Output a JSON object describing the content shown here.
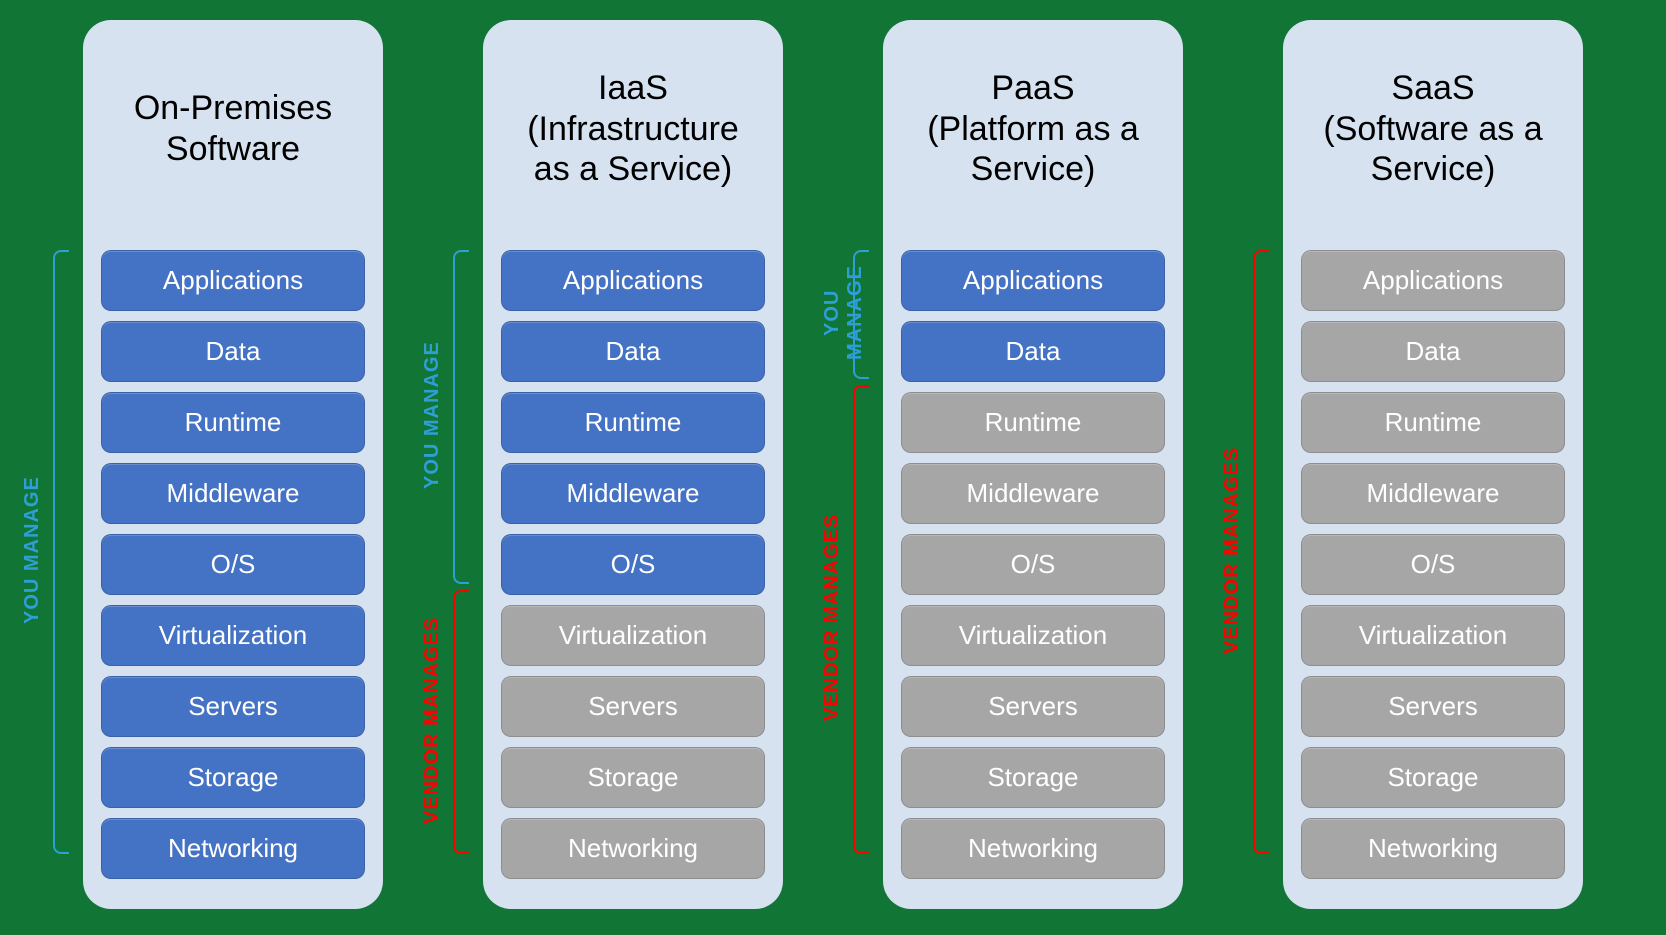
{
  "labels": {
    "you": "YOU MANAGE",
    "vendor": "VENDOR MANAGES"
  },
  "layerNames": [
    "Applications",
    "Data",
    "Runtime",
    "Middleware",
    "O/S",
    "Virtualization",
    "Servers",
    "Storage",
    "Networking"
  ],
  "columns": [
    {
      "title_l1": "On-Premises",
      "title_l2": "Software",
      "youCount": 9,
      "vendorCount": 0
    },
    {
      "title_l1": "IaaS",
      "title_l2": "(Infrastructure",
      "title_l3": "as a Service)",
      "youCount": 5,
      "vendorCount": 4
    },
    {
      "title_l1": "PaaS",
      "title_l2": "(Platform as a",
      "title_l3": "Service)",
      "youCount": 2,
      "vendorCount": 7
    },
    {
      "title_l1": "SaaS",
      "title_l2": "(Software as a",
      "title_l3": "Service)",
      "youCount": 0,
      "vendorCount": 9
    }
  ]
}
